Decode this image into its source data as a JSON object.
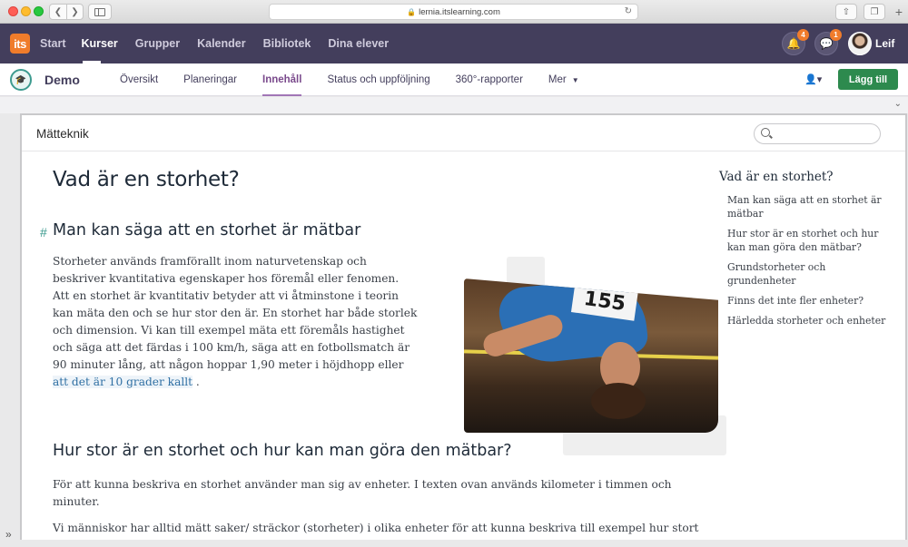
{
  "browser": {
    "url": "lernia.itslearning.com"
  },
  "app": {
    "logo_text": "its",
    "nav": [
      "Start",
      "Kurser",
      "Grupper",
      "Kalender",
      "Bibliotek",
      "Dina elever"
    ],
    "notifications_count": "4",
    "messages_count": "1",
    "user_name": "Leif"
  },
  "course": {
    "name": "Demo",
    "tabs": [
      "Översikt",
      "Planeringar",
      "Innehåll",
      "Status och uppföljning",
      "360°-rapporter",
      "Mer"
    ],
    "active_tab": "Innehåll",
    "add_button": "Lägg till"
  },
  "page": {
    "title": "Mätteknik",
    "search_placeholder": ""
  },
  "article": {
    "h1": "Vad är en storhet?",
    "h2_1": "Man kan säga att en storhet är mätbar",
    "p1_text": "Storheter används framförallt inom naturvetenskap och beskriver kvantitativa egenskaper hos föremål eller fenomen. Att en storhet är kvantitativ betyder att vi åtminstone i teorin kan mäta den och se hur stor den är. En storhet har både storlek och dimension. Vi kan till exempel mäta ett föremåls hastighet och säga att det färdas i 100 km/h, säga att en fotbollsmatch är 90 minuter lång, att någon hoppar 1,90 meter i höjdhopp eller",
    "p1_link": "att det är 10 grader kallt",
    "p1_end": " .",
    "photo_bib": "155",
    "h2_2": "Hur stor är en storhet och hur kan man göra den mätbar?",
    "p2": "För att kunna beskriva en storhet använder man sig av enheter. I texten ovan används kilometer i timmen och minuter.",
    "p3": "Vi människor har alltid mätt saker/ sträckor (storheter) i olika enheter för att kunna beskriva till exempel hur stort"
  },
  "toc": {
    "title": "Vad är en storhet?",
    "items": [
      "Man kan säga att en storhet är mätbar",
      "Hur stor är en storhet och hur kan man göra den mätbar?",
      "Grundstorheter och grundenheter",
      "Finns det inte fler enheter?",
      "Härledda storheter och enheter"
    ]
  }
}
